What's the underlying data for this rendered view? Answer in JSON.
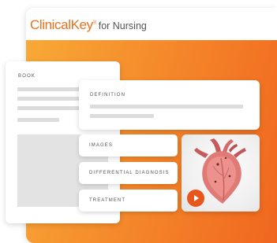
{
  "header": {
    "brand": "ClinicalKey",
    "brand_suffix": "®",
    "subtitle": "for Nursing"
  },
  "book_card": {
    "label": "BOOK"
  },
  "definition_card": {
    "label": "DEFINITION"
  },
  "topics": [
    {
      "label": "IMAGES"
    },
    {
      "label": "DIFFERENTIAL DIAGNOSIS"
    },
    {
      "label": "TREATMENT"
    }
  ],
  "media": {
    "icon": "play-icon",
    "subject": "heart-illustration"
  },
  "colors": {
    "brand": "#e9711c",
    "gradient_start": "#f8a937",
    "gradient_end": "#f0661f",
    "play_button": "#e8551d"
  }
}
